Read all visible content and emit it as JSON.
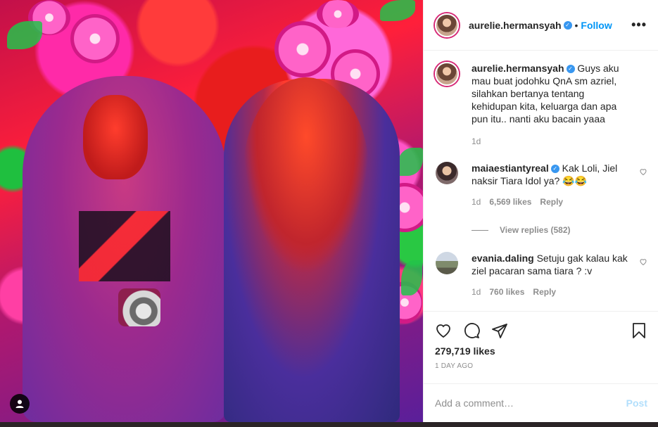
{
  "post": {
    "author": "aurelie.hermansyah",
    "follow_label": "Follow",
    "separator": "•",
    "more_label": "•••"
  },
  "caption": {
    "username": "aurelie.hermansyah",
    "text": "Guys aku mau buat jodohku QnA sm azriel, silahkan bertanya tentang kehidupan kita, keluarga dan apa pun itu.. nanti aku bacain yaaa",
    "time": "1d"
  },
  "comments": [
    {
      "username": "maiaestiantyreal",
      "verified": true,
      "text": "Kak Loli, Jiel naksir Tiara Idol ya? 😂😂",
      "time": "1d",
      "likes": "6,569 likes",
      "reply_label": "Reply",
      "view_replies": "View replies (582)"
    },
    {
      "username": "evania.daling",
      "verified": false,
      "text": "Setuju gak kalau kak ziel pacaran sama tiara ? :v",
      "time": "1d",
      "likes": "760 likes",
      "reply_label": "Reply"
    }
  ],
  "actions": {
    "likes": "279,719 likes",
    "date": "1 DAY AGO",
    "icons": [
      "heart-icon",
      "comment-icon",
      "share-icon",
      "bookmark-icon"
    ]
  },
  "add_comment": {
    "placeholder": "Add a comment…",
    "post_label": "Post"
  },
  "colors": {
    "accent": "#0095f6",
    "verified": "#3897f0",
    "muted": "#8e8e8e",
    "post_disabled": "#b2dffc"
  }
}
